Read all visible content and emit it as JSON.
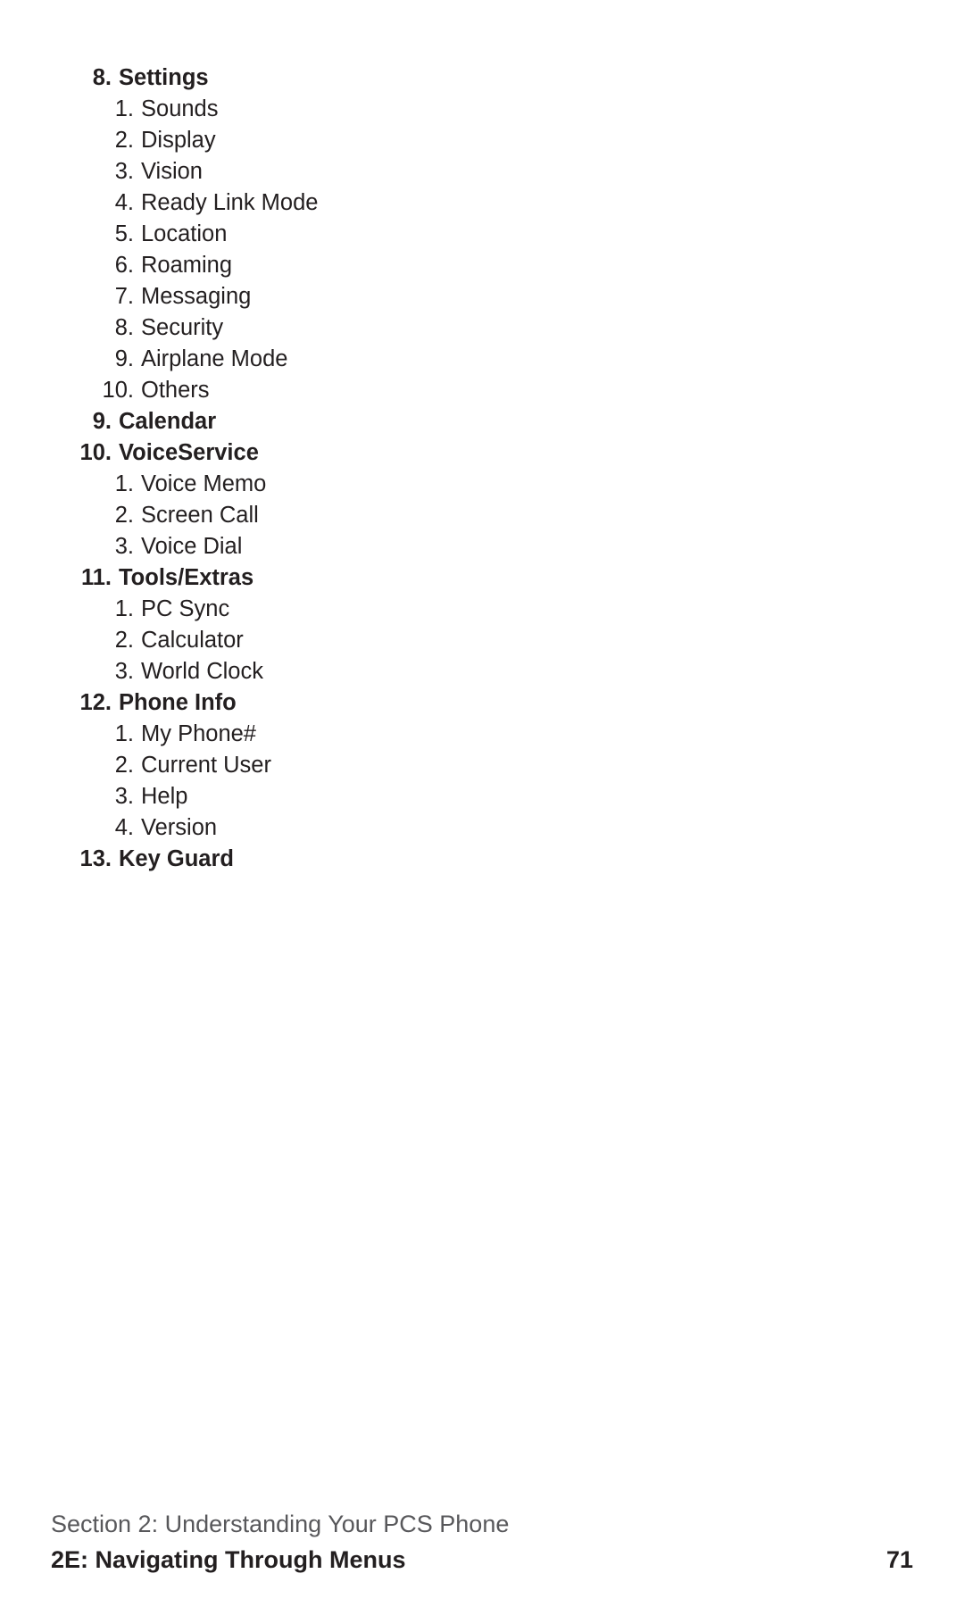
{
  "document": {
    "menu_outline": [
      {
        "level": 1,
        "number": "8.",
        "label": "Settings"
      },
      {
        "level": 2,
        "number": "1.",
        "label": "Sounds"
      },
      {
        "level": 2,
        "number": "2.",
        "label": "Display"
      },
      {
        "level": 2,
        "number": "3.",
        "label": "Vision"
      },
      {
        "level": 2,
        "number": "4.",
        "label": "Ready Link Mode"
      },
      {
        "level": 2,
        "number": "5.",
        "label": "Location"
      },
      {
        "level": 2,
        "number": "6.",
        "label": "Roaming"
      },
      {
        "level": 2,
        "number": "7.",
        "label": "Messaging"
      },
      {
        "level": 2,
        "number": "8.",
        "label": "Security"
      },
      {
        "level": 2,
        "number": "9.",
        "label": "Airplane Mode"
      },
      {
        "level": 2,
        "number": "10.",
        "label": "Others"
      },
      {
        "level": 1,
        "number": "9.",
        "label": "Calendar"
      },
      {
        "level": 1,
        "number": "10.",
        "label": "VoiceService"
      },
      {
        "level": 2,
        "number": "1.",
        "label": "Voice Memo"
      },
      {
        "level": 2,
        "number": "2.",
        "label": "Screen Call"
      },
      {
        "level": 2,
        "number": "3.",
        "label": "Voice Dial"
      },
      {
        "level": 1,
        "number": "11.",
        "label": "Tools/Extras"
      },
      {
        "level": 2,
        "number": "1.",
        "label": "PC Sync"
      },
      {
        "level": 2,
        "number": "2.",
        "label": "Calculator"
      },
      {
        "level": 2,
        "number": "3.",
        "label": "World Clock"
      },
      {
        "level": 1,
        "number": "12.",
        "label": "Phone Info"
      },
      {
        "level": 2,
        "number": "1.",
        "label": "My Phone#"
      },
      {
        "level": 2,
        "number": "2.",
        "label": "Current User"
      },
      {
        "level": 2,
        "number": "3.",
        "label": "Help"
      },
      {
        "level": 2,
        "number": "4.",
        "label": "Version"
      },
      {
        "level": 1,
        "number": "13.",
        "label": "Key Guard"
      }
    ],
    "footer": {
      "section_line": "Section 2: Understanding Your PCS Phone",
      "chapter_title": "2E: Navigating Through Menus",
      "page_number": "71"
    }
  }
}
